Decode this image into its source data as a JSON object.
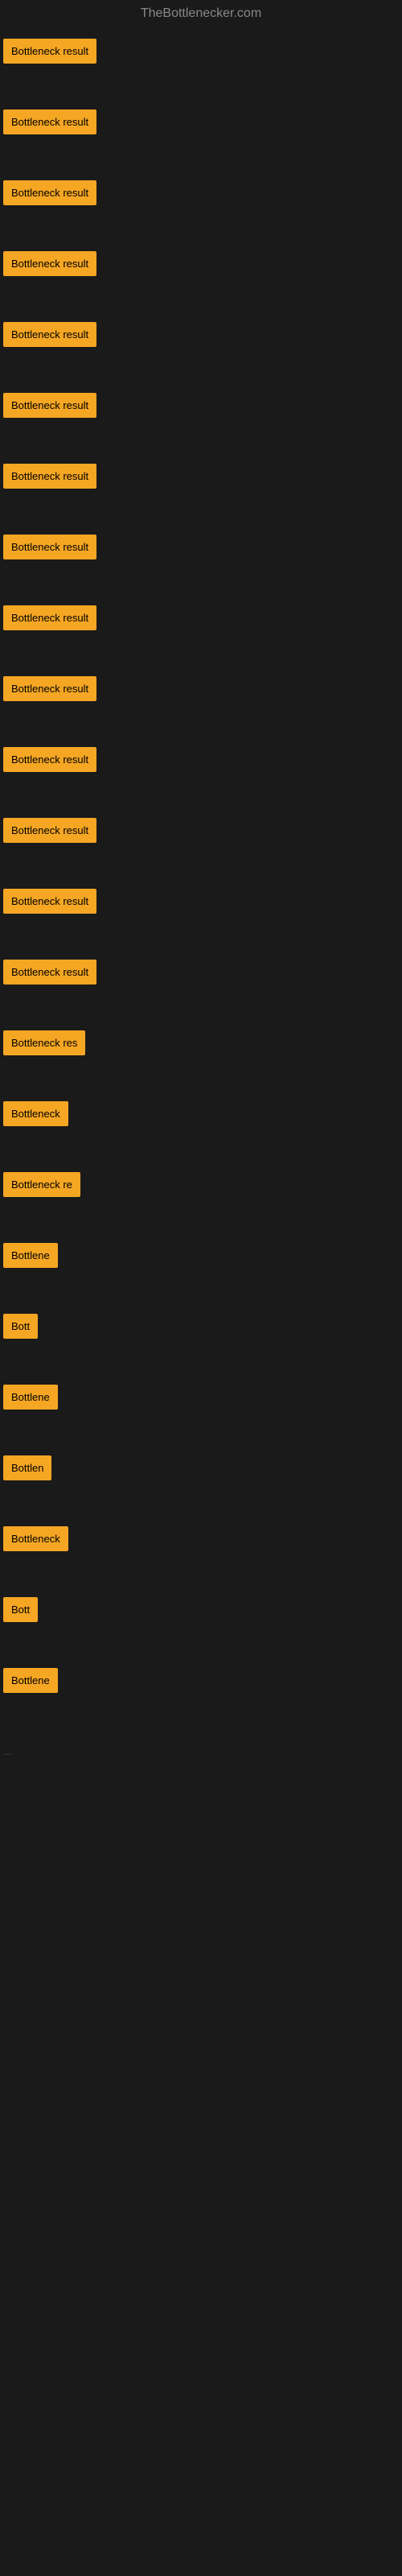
{
  "header": {
    "title": "TheBottlenecker.com"
  },
  "items": [
    {
      "id": 1,
      "label": "Bottleneck result",
      "width_class": "item-w-full"
    },
    {
      "id": 2,
      "label": "Bottleneck result",
      "width_class": "item-w-full"
    },
    {
      "id": 3,
      "label": "Bottleneck result",
      "width_class": "item-w-full"
    },
    {
      "id": 4,
      "label": "Bottleneck result",
      "width_class": "item-w-full"
    },
    {
      "id": 5,
      "label": "Bottleneck result",
      "width_class": "item-w-full"
    },
    {
      "id": 6,
      "label": "Bottleneck result",
      "width_class": "item-w-full"
    },
    {
      "id": 7,
      "label": "Bottleneck result",
      "width_class": "item-w-full"
    },
    {
      "id": 8,
      "label": "Bottleneck result",
      "width_class": "item-w-full"
    },
    {
      "id": 9,
      "label": "Bottleneck result",
      "width_class": "item-w-full"
    },
    {
      "id": 10,
      "label": "Bottleneck result",
      "width_class": "item-w-full"
    },
    {
      "id": 11,
      "label": "Bottleneck result",
      "width_class": "item-w-full"
    },
    {
      "id": 12,
      "label": "Bottleneck result",
      "width_class": "item-w-full"
    },
    {
      "id": 13,
      "label": "Bottleneck result",
      "width_class": "item-w-full"
    },
    {
      "id": 14,
      "label": "Bottleneck result",
      "width_class": "item-w-full"
    },
    {
      "id": 15,
      "label": "Bottleneck res",
      "width_class": "item-w-1"
    },
    {
      "id": 16,
      "label": "Bottleneck",
      "width_class": "item-w-3"
    },
    {
      "id": 17,
      "label": "Bottleneck re",
      "width_class": "item-w-2"
    },
    {
      "id": 18,
      "label": "Bottlene",
      "width_class": "item-w-4"
    },
    {
      "id": 19,
      "label": "Bott",
      "width_class": "item-w-6"
    },
    {
      "id": 20,
      "label": "Bottlene",
      "width_class": "item-w-4"
    },
    {
      "id": 21,
      "label": "Bottlen",
      "width_class": "item-w-5"
    },
    {
      "id": 22,
      "label": "Bottleneck",
      "width_class": "item-w-3"
    },
    {
      "id": 23,
      "label": "Bott",
      "width_class": "item-w-7"
    },
    {
      "id": 24,
      "label": "Bottlene",
      "width_class": "item-w-4"
    }
  ],
  "ellipsis": "..."
}
